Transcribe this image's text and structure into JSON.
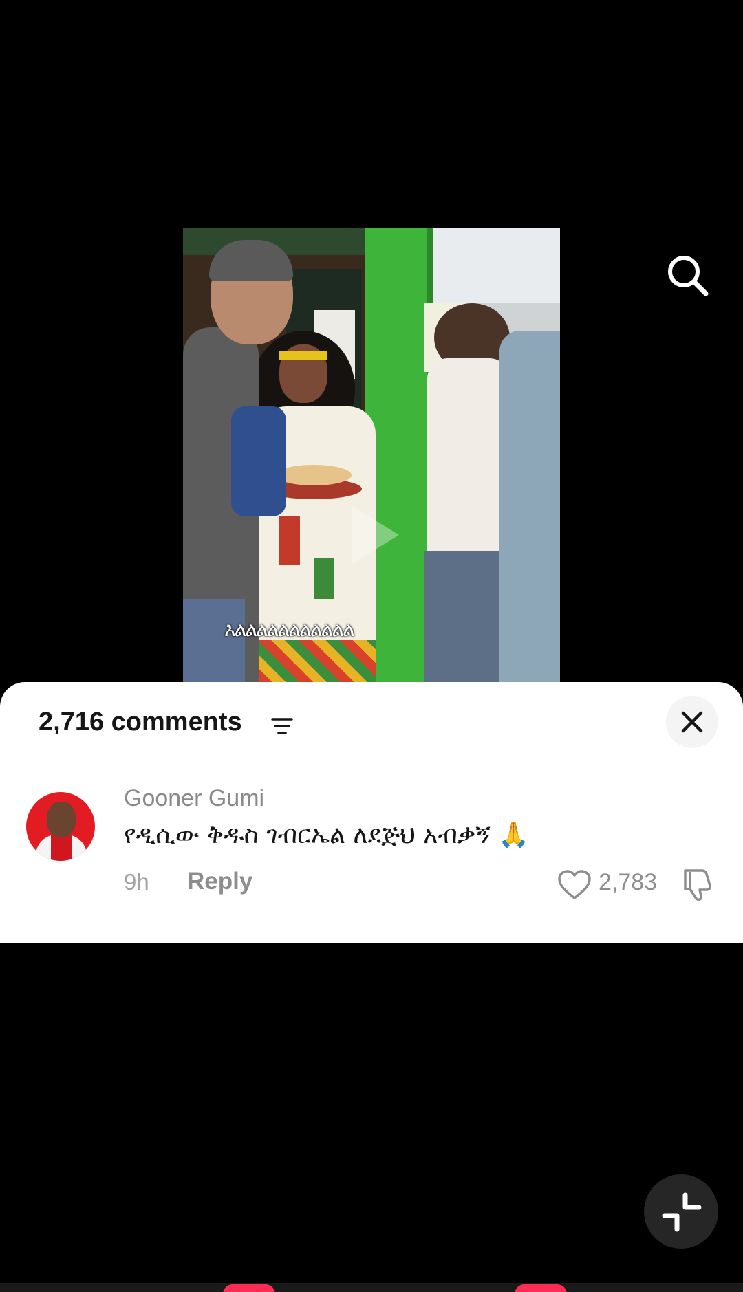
{
  "video": {
    "caption": "እልልልልልልልልልልል",
    "play_icon": "play-icon"
  },
  "top_right": {
    "search_icon": "search-icon"
  },
  "comments_panel": {
    "count_label": "2,716 comments",
    "filter_icon": "sort-filter-icon",
    "close_icon": "close-icon",
    "comments": [
      {
        "username": "Gooner Gumi",
        "text": "የዲሲው ቅዱስ ገብርኤል ለደጅህ አብቃኝ 🙏",
        "time": "9h",
        "reply_label": "Reply",
        "like_count": "2,783",
        "like_icon": "heart-icon",
        "dislike_icon": "thumbs-down-icon"
      }
    ]
  },
  "minimize_icon": "minimize-icon",
  "colors": {
    "accent": "#fe2c55",
    "sheet_bg": "#ffffff",
    "background": "#000000"
  }
}
